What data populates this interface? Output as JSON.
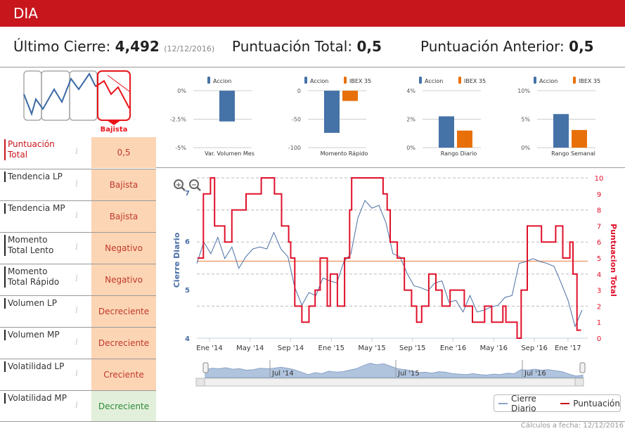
{
  "header": {
    "title": "DIA"
  },
  "summary": {
    "last_close_label": "Último Cierre:",
    "last_close_value": "4,492",
    "last_close_date": "(12/12/2016)",
    "total_score_label": "Puntuación Total:",
    "total_score_value": "0,5",
    "prev_score_label": "Puntuación Anterior:",
    "prev_score_value": "0,5"
  },
  "trend_badge": "Bajista",
  "indicators": [
    {
      "label": "Puntuación Total",
      "value": "0,5",
      "style": "orange",
      "highlight": true
    },
    {
      "label": "Tendencia LP",
      "value": "Bajista",
      "style": "orange"
    },
    {
      "label": "Tendencia MP",
      "value": "Bajista",
      "style": "orange"
    },
    {
      "label": "Momento Total Lento",
      "value": "Negativo",
      "style": "orange"
    },
    {
      "label": "Momento Total Rápido",
      "value": "Negativo",
      "style": "orange"
    },
    {
      "label": "Volumen LP",
      "value": "Decreciente",
      "style": "orange"
    },
    {
      "label": "Volumen MP",
      "value": "Decreciente",
      "style": "orange"
    },
    {
      "label": "Volatilidad LP",
      "value": "Creciente",
      "style": "orange"
    },
    {
      "label": "Volatilidad MP",
      "value": "Decreciente",
      "style": "green"
    }
  ],
  "info_icon": "i",
  "colors": {
    "accion": "#4572a7",
    "ibex": "#e8700a",
    "price": "#4a6fa5",
    "score": "#e0102a",
    "mean": "#f0a070",
    "brand": "#c8161d"
  },
  "chart_data": [
    {
      "type": "bar",
      "title": "Var. Volumen Mes",
      "series": [
        {
          "name": "Accion",
          "values": [
            -2.7
          ]
        }
      ],
      "yticks": [
        "0%",
        "-2.5%",
        "-5%"
      ],
      "ylim": [
        -5,
        0
      ]
    },
    {
      "type": "bar",
      "title": "Momento Rápido",
      "series": [
        {
          "name": "Accion",
          "values": [
            -74
          ]
        },
        {
          "name": "IBEX 35",
          "values": [
            -18
          ]
        }
      ],
      "yticks": [
        "0",
        "-50",
        "-100"
      ],
      "ylim": [
        -100,
        0
      ]
    },
    {
      "type": "bar",
      "title": "Rango Diario",
      "series": [
        {
          "name": "Accion",
          "values": [
            2.2
          ]
        },
        {
          "name": "IBEX 35",
          "values": [
            1.2
          ]
        }
      ],
      "yticks": [
        "4%",
        "2%",
        "0%"
      ],
      "ylim": [
        0,
        4
      ]
    },
    {
      "type": "bar",
      "title": "Rango Semanal",
      "series": [
        {
          "name": "Accion",
          "values": [
            5.9
          ]
        },
        {
          "name": "IBEX 35",
          "values": [
            3.1
          ]
        }
      ],
      "yticks": [
        "10%",
        "5%",
        "0%"
      ],
      "ylim": [
        0,
        10
      ]
    },
    {
      "type": "line",
      "ylabel": "Cierre Diario",
      "y2label": "Puntuacion Total",
      "ylim": [
        4,
        7
      ],
      "y2lim": [
        0,
        10
      ],
      "mean_score": 4.8,
      "xticks": [
        "Ene '14",
        "May '14",
        "Sep '14",
        "Ene '15",
        "May '15",
        "Sep '15",
        "Ene '16",
        "May '16",
        "Sep '16",
        "Ene '17"
      ],
      "yticks": [
        "7",
        "6",
        "5",
        "4"
      ],
      "y2ticks": [
        "10",
        "9",
        "8",
        "7",
        "6",
        "5",
        "4",
        "3",
        "2",
        "1",
        "0"
      ],
      "navigator_labels": [
        "Jul '14",
        "Jul '15",
        "Jul '16"
      ],
      "series": [
        {
          "name": "Cierre Diario",
          "x_start_month": -1.25,
          "x_step_months": 0.69,
          "values": [
            5.6,
            5.9,
            5.8,
            6.0,
            5.7,
            5.8,
            5.5,
            5.6,
            5.9,
            5.8,
            5.9,
            6.1,
            5.9,
            5.6,
            5.1,
            4.6,
            5.0,
            4.8,
            5.3,
            5.1,
            5.2,
            5.5,
            5.8,
            6.4,
            6.9,
            6.6,
            6.8,
            6.3,
            5.8,
            5.6,
            5.4,
            5.0,
            5.1,
            4.9,
            5.2,
            5.1,
            4.8,
            4.7,
            4.6,
            4.8,
            4.6,
            4.5,
            4.7,
            4.6,
            4.9,
            4.8,
            5.6,
            5.5,
            5.7,
            5.5,
            5.6,
            5.4,
            5.2,
            4.7,
            4.3,
            4.5
          ]
        },
        {
          "name": "Puntuación",
          "step": true,
          "points": [
            [
              -1.2,
              5
            ],
            [
              -0.6,
              9
            ],
            [
              0.1,
              10
            ],
            [
              0.5,
              7
            ],
            [
              1.5,
              6
            ],
            [
              2.2,
              8
            ],
            [
              3.6,
              9
            ],
            [
              5.1,
              10
            ],
            [
              6.4,
              9
            ],
            [
              7.1,
              7
            ],
            [
              7.8,
              6
            ],
            [
              8.0,
              5
            ],
            [
              8.4,
              2
            ],
            [
              9.1,
              1
            ],
            [
              9.8,
              2
            ],
            [
              10.4,
              3
            ],
            [
              10.9,
              5
            ],
            [
              11.6,
              2
            ],
            [
              11.9,
              4
            ],
            [
              12.6,
              2
            ],
            [
              13.3,
              5
            ],
            [
              13.8,
              8
            ],
            [
              14.0,
              10
            ],
            [
              17.1,
              9
            ],
            [
              17.5,
              8
            ],
            [
              17.8,
              6
            ],
            [
              18.5,
              5
            ],
            [
              19.2,
              3
            ],
            [
              19.9,
              2
            ],
            [
              20.4,
              1
            ],
            [
              20.9,
              2
            ],
            [
              21.6,
              4
            ],
            [
              22.3,
              3
            ],
            [
              22.9,
              2
            ],
            [
              23.7,
              3
            ],
            [
              25.1,
              2
            ],
            [
              25.9,
              1
            ],
            [
              27.1,
              2
            ],
            [
              27.8,
              1
            ],
            [
              28.9,
              2
            ],
            [
              29.2,
              1
            ],
            [
              30.3,
              0
            ],
            [
              30.7,
              3
            ],
            [
              31.3,
              7
            ],
            [
              32.7,
              6
            ],
            [
              34.1,
              7
            ],
            [
              34.8,
              5
            ],
            [
              35.5,
              6
            ],
            [
              35.8,
              4
            ],
            [
              36.2,
              0.5
            ],
            [
              36.6,
              0.5
            ]
          ]
        }
      ]
    }
  ],
  "legend": {
    "price": "Cierre Diario",
    "score": "Puntuación"
  },
  "footer": "Cálculos a fecha: 12/12/2016"
}
